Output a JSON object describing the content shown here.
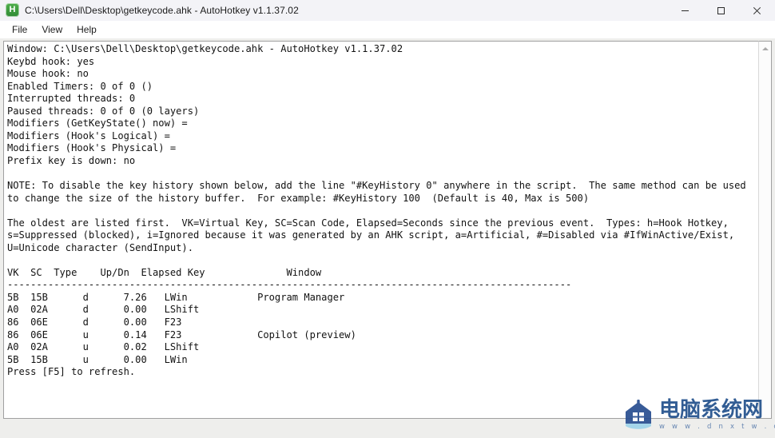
{
  "window": {
    "title": "C:\\Users\\Dell\\Desktop\\getkeycode.ahk - AutoHotkey v1.1.37.02",
    "icon_letter": "H",
    "icon_name": "autohotkey-icon",
    "accent_green": "#3f9c3f",
    "titlebar_bg": "#f3f3f7",
    "controls": {
      "minimize": "minimize",
      "maximize": "maximize",
      "close": "close"
    }
  },
  "menu": {
    "items": [
      {
        "label": "File"
      },
      {
        "label": "View"
      },
      {
        "label": "Help"
      }
    ]
  },
  "console": {
    "text": "Window: C:\\Users\\Dell\\Desktop\\getkeycode.ahk - AutoHotkey v1.1.37.02\nKeybd hook: yes\nMouse hook: no\nEnabled Timers: 0 of 0 ()\nInterrupted threads: 0\nPaused threads: 0 of 0 (0 layers)\nModifiers (GetKeyState() now) = \nModifiers (Hook's Logical) = \nModifiers (Hook's Physical) = \nPrefix key is down: no\n\nNOTE: To disable the key history shown below, add the line \"#KeyHistory 0\" anywhere in the script.  The same method can be used\nto change the size of the history buffer.  For example: #KeyHistory 100  (Default is 40, Max is 500)\n\nThe oldest are listed first.  VK=Virtual Key, SC=Scan Code, Elapsed=Seconds since the previous event.  Types: h=Hook Hotkey,\ns=Suppressed (blocked), i=Ignored because it was generated by an AHK script, a=Artificial, #=Disabled via #IfWinActive/Exist,\nU=Unicode character (SendInput).\n\nVK  SC  Type    Up/Dn  Elapsed Key              Window\n-------------------------------------------------------------------------------------------------\n5B  15B      d      7.26   LWin            Program Manager\nA0  02A      d      0.00   LShift\n86  06E      d      0.00   F23\n86  06E      u      0.14   F23             Copilot (preview)\nA0  02A      u      0.02   LShift\n5B  15B      u      0.00   LWin\nPress [F5] to refresh.",
    "status_lines": {
      "window": "Window: C:\\Users\\Dell\\Desktop\\getkeycode.ahk - AutoHotkey v1.1.37.02",
      "keybd_hook": "Keybd hook: yes",
      "mouse_hook": "Mouse hook: no",
      "enabled_timers": "Enabled Timers: 0 of 0 ()",
      "interrupted_threads": "Interrupted threads: 0",
      "paused_threads": "Paused threads: 0 of 0 (0 layers)",
      "modifiers_getkeystate": "Modifiers (GetKeyState() now) =",
      "modifiers_logical": "Modifiers (Hook's Logical) =",
      "modifiers_physical": "Modifiers (Hook's Physical) =",
      "prefix_key": "Prefix key is down: no"
    },
    "note": "NOTE: To disable the key history shown below, add the line \"#KeyHistory 0\" anywhere in the script.  The same method can be used to change the size of the history buffer.  For example: #KeyHistory 100  (Default is 40, Max is 500)",
    "legend": "The oldest are listed first.  VK=Virtual Key, SC=Scan Code, Elapsed=Seconds since the previous event.  Types: h=Hook Hotkey, s=Suppressed (blocked), i=Ignored because it was generated by an AHK script, a=Artificial, #=Disabled via #IfWinActive/Exist, U=Unicode character (SendInput).",
    "table": {
      "headers": [
        "VK",
        "SC",
        "Type",
        "Up/Dn",
        "Elapsed",
        "Key",
        "Window"
      ],
      "rows": [
        {
          "vk": "5B",
          "sc": "15B",
          "type": "",
          "updn": "d",
          "elapsed": "7.26",
          "key": "LWin",
          "window": "Program Manager"
        },
        {
          "vk": "A0",
          "sc": "02A",
          "type": "",
          "updn": "d",
          "elapsed": "0.00",
          "key": "LShift",
          "window": ""
        },
        {
          "vk": "86",
          "sc": "06E",
          "type": "",
          "updn": "d",
          "elapsed": "0.00",
          "key": "F23",
          "window": ""
        },
        {
          "vk": "86",
          "sc": "06E",
          "type": "",
          "updn": "u",
          "elapsed": "0.14",
          "key": "F23",
          "window": "Copilot (preview)"
        },
        {
          "vk": "A0",
          "sc": "02A",
          "type": "",
          "updn": "u",
          "elapsed": "0.02",
          "key": "LShift",
          "window": ""
        },
        {
          "vk": "5B",
          "sc": "15B",
          "type": "",
          "updn": "u",
          "elapsed": "0.00",
          "key": "LWin",
          "window": ""
        }
      ]
    },
    "footer": "Press [F5] to refresh."
  },
  "watermark": {
    "cn_text": "电脑系统网",
    "url_text": "w w w . d n x t w . c o m",
    "logo_color": "#23518c",
    "accent_color": "#5d7fae"
  }
}
